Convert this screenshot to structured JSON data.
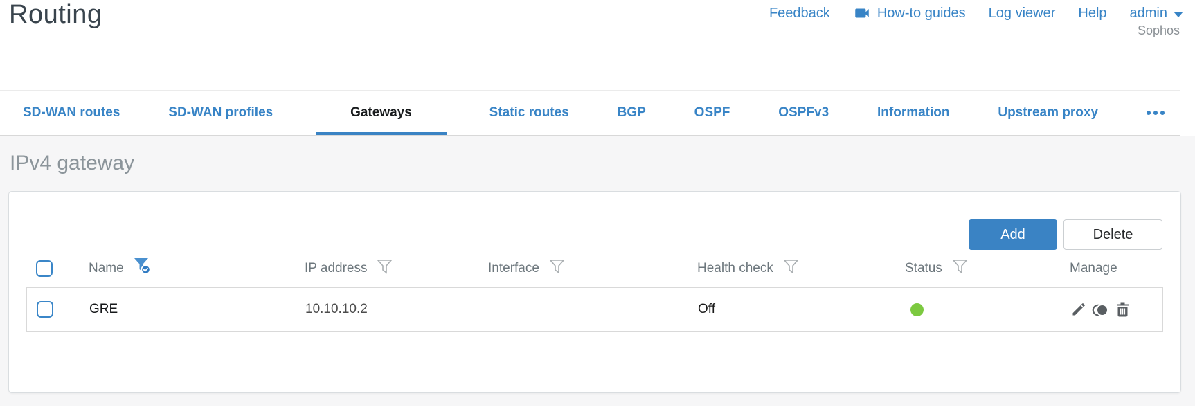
{
  "header": {
    "title": "Routing",
    "nav": {
      "feedback": "Feedback",
      "howto_guides": "How-to guides",
      "log_viewer": "Log viewer",
      "help": "Help",
      "user": "admin"
    },
    "brand": "Sophos"
  },
  "tabs": {
    "items": [
      {
        "label": "SD-WAN routes",
        "active": false
      },
      {
        "label": "SD-WAN profiles",
        "active": false
      },
      {
        "label": "Gateways",
        "active": true
      },
      {
        "label": "Static routes",
        "active": false
      },
      {
        "label": "BGP",
        "active": false
      },
      {
        "label": "OSPF",
        "active": false
      },
      {
        "label": "OSPFv3",
        "active": false
      },
      {
        "label": "Information",
        "active": false
      },
      {
        "label": "Upstream proxy",
        "active": false
      }
    ],
    "more": "ellipsis-icon"
  },
  "section": {
    "heading": "IPv4 gateway"
  },
  "toolbar": {
    "add_label": "Add",
    "delete_label": "Delete"
  },
  "table": {
    "columns": [
      {
        "label": "Name",
        "filter": "active-with-check"
      },
      {
        "label": "IP address",
        "filter": "default"
      },
      {
        "label": "Interface",
        "filter": "default"
      },
      {
        "label": "Health check",
        "filter": "default"
      },
      {
        "label": "Status",
        "filter": "default"
      },
      {
        "label": "Manage",
        "filter": "none"
      }
    ],
    "rows": [
      {
        "name": "GRE",
        "ip_address": "10.10.10.2",
        "interface": "",
        "health_check": "Off",
        "status": "up",
        "manage_icons": [
          "pencil-icon",
          "clone-icon",
          "trash-icon"
        ]
      }
    ]
  },
  "colors": {
    "accent_blue": "#3884c6",
    "button_blue": "#3a83c4",
    "status_green": "#7cc940",
    "heading_gray": "#8c959b",
    "icon_gray": "#595e62"
  }
}
